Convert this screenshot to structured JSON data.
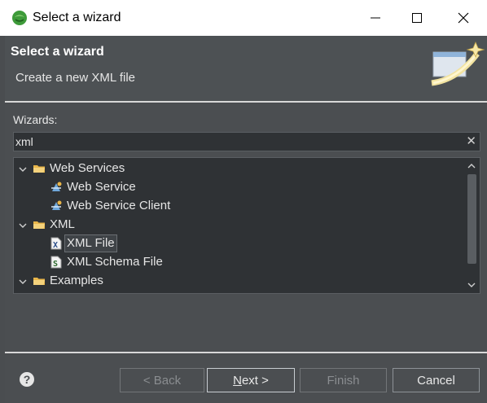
{
  "window": {
    "title": "Select a wizard",
    "icon": "eclipse-app-icon",
    "controls": [
      "minimize-icon",
      "maximize-icon",
      "close-icon"
    ]
  },
  "banner": {
    "title": "Select a wizard",
    "description": "Create a new XML file",
    "image": "wizard-banner-icon"
  },
  "wizards": {
    "label": "Wizards:",
    "filter_value": "xml",
    "clear_icon": "clear-icon"
  },
  "tree": {
    "items": [
      {
        "label": "Web Services",
        "level": 0,
        "expanded": true,
        "icon": "folder-icon"
      },
      {
        "label": "Web Service",
        "level": 1,
        "icon": "web-service-icon"
      },
      {
        "label": "Web Service Client",
        "level": 1,
        "icon": "web-service-client-icon"
      },
      {
        "label": "XML",
        "level": 0,
        "expanded": true,
        "icon": "folder-icon"
      },
      {
        "label": "XML File",
        "level": 1,
        "icon": "xml-file-icon",
        "selected": true
      },
      {
        "label": "XML Schema File",
        "level": 1,
        "icon": "xml-schema-file-icon"
      },
      {
        "label": "Examples",
        "level": 0,
        "expanded": true,
        "icon": "folder-icon"
      }
    ]
  },
  "buttons": {
    "back": {
      "label": "< Back",
      "enabled": false
    },
    "next_prefix": "N",
    "next_rest": "ext >",
    "finish": {
      "label": "Finish",
      "enabled": false
    },
    "cancel": {
      "label": "Cancel",
      "enabled": true
    }
  },
  "colors": {
    "dialog_bg": "#4b4e51",
    "tree_bg": "#2f3235",
    "text": "#e6e6e6",
    "folder": "#e9b64a"
  }
}
